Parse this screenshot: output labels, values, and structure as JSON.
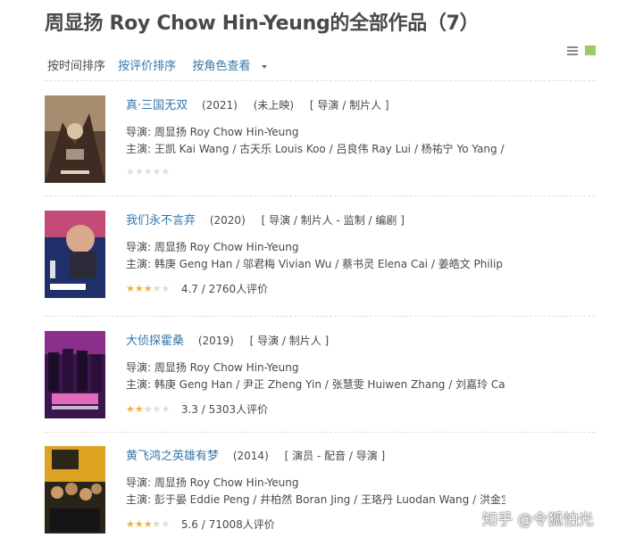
{
  "page": {
    "title": "周显扬 Roy Chow Hin-Yeung的全部作品（7）"
  },
  "sort": {
    "by_time": "按时间排序",
    "by_rating": "按评价排序",
    "by_role": "按角色查看"
  },
  "items": [
    {
      "title": "真·三国无双",
      "year": "(2021)",
      "status": "(未上映)",
      "roles": "[ 导演 / 制片人 ]",
      "director": "导演: 周显扬 Roy Chow Hin-Yeung",
      "cast": "主演: 王凯 Kai Wang / 古天乐 Louis Koo / 吕良伟 Ray Lui / 杨祐宁 Yo Yang / 刘...",
      "rating_stars": 0,
      "rating_text": "",
      "poster_colors": [
        "#6b4f3a",
        "#c9b49a"
      ]
    },
    {
      "title": "我们永不言弃",
      "year": "(2020)",
      "status": "",
      "roles": "[ 导演 / 制片人 - 监制 / 编剧 ]",
      "director": "导演: 周显扬 Roy Chow Hin-Yeung",
      "cast": "主演: 韩庚 Geng Han / 邬君梅 Vivian Wu / 蔡书灵 Elena Cai / 姜皓文 Philip Keun...",
      "rating_stars": 2.5,
      "rating_text": "4.7 / 2760人评价",
      "poster_colors": [
        "#2a3d7a",
        "#c84a6a"
      ]
    },
    {
      "title": "大侦探霍桑",
      "year": "(2019)",
      "status": "",
      "roles": "[ 导演 / 制片人 ]",
      "director": "导演: 周显扬 Roy Chow Hin-Yeung",
      "cast": "主演: 韩庚 Geng Han / 尹正 Zheng Yin / 张慧雯 Huiwen Zhang / 刘嘉玲 Carina Lau...",
      "rating_stars": 2,
      "rating_text": "3.3 / 5303人评价",
      "poster_colors": [
        "#4a1f5c",
        "#b04fa0"
      ]
    },
    {
      "title": "黄飞鸿之英雄有梦",
      "year": "(2014)",
      "status": "",
      "roles": "[ 演员 - 配音 / 导演 ]",
      "director": "导演: 周显扬 Roy Chow Hin-Yeung",
      "cast": "主演: 彭于晏 Eddie Peng / 井柏然 Boran Jing / 王珞丹 Luodan Wang / 洪金宝 Samm...",
      "rating_stars": 3,
      "rating_text": "5.6 / 71008人评价",
      "poster_colors": [
        "#d9a21f",
        "#1a1a1a"
      ]
    }
  ],
  "watermark": "知乎 @令狐怕光",
  "icons": {
    "list_view": "list-view-icon",
    "grid_view": "grid-view-icon"
  },
  "colors": {
    "link": "#37a",
    "star": "#f5b13c",
    "grid_active": "#9c6"
  }
}
